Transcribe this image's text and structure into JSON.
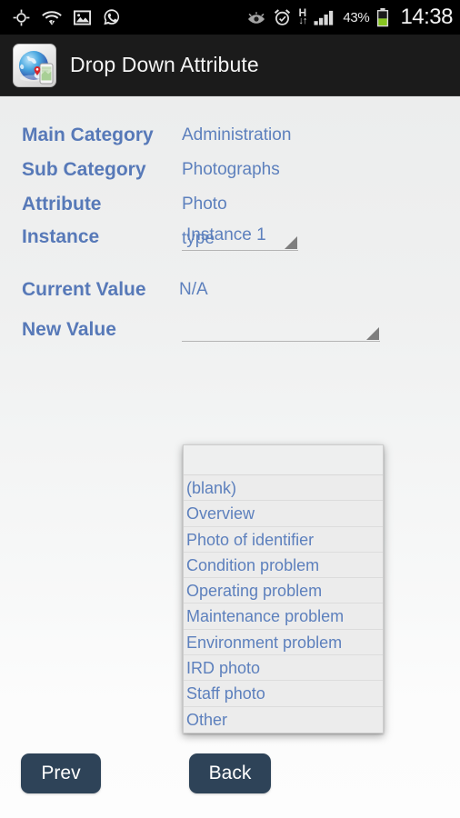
{
  "status_bar": {
    "icons_left": [
      "gps-crosshair-icon",
      "wifi-question-icon",
      "image-icon",
      "whatsapp-icon"
    ],
    "icons_right": [
      "smart-stay-eye-icon",
      "alarm-clock-icon",
      "hspa-data-icon",
      "signal-bars-icon",
      "battery-icon"
    ],
    "network_type": "H",
    "battery_percent": "43%",
    "clock": "14:38"
  },
  "title_bar": {
    "icon": "globe-phone-app-icon",
    "title": "Drop Down Attribute"
  },
  "form": {
    "main_category": {
      "label": "Main Category",
      "value": "Administration"
    },
    "sub_category": {
      "label": "Sub Category",
      "value": "Photographs"
    },
    "attribute": {
      "label": "Attribute",
      "value": "Photo type"
    },
    "instance": {
      "label": "Instance",
      "value": "Instance 1"
    },
    "current_value": {
      "label": "Current Value",
      "value": "N/A"
    },
    "new_value": {
      "label": "New Value",
      "value": ""
    }
  },
  "dropdown": {
    "open": true,
    "options": [
      "(blank)",
      "Overview",
      "Photo of identifier",
      "Condition problem",
      "Operating problem",
      "Maintenance problem",
      "Environment problem",
      "IRD photo",
      "Staff photo",
      "Other"
    ]
  },
  "buttons": {
    "prev": "Prev",
    "back": "Back"
  },
  "colors": {
    "label_blue": "#5779b8",
    "value_blue": "#5d80bd",
    "button_navy": "#2e4358",
    "title_bar_bg": "#1b1b1b",
    "status_bar_bg": "#000000",
    "page_bg": "#eceded",
    "dropdown_bg": "#ececec"
  }
}
